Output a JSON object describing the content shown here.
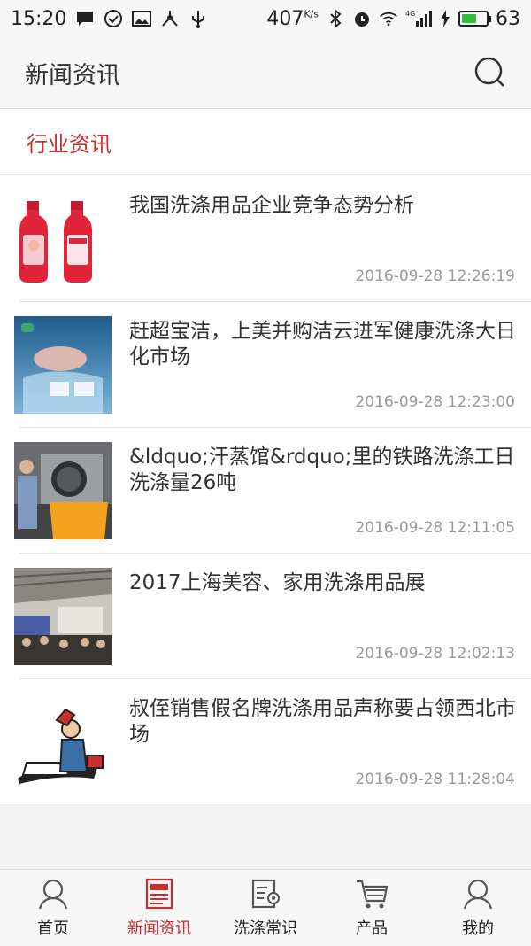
{
  "status_bar": {
    "time": "15:20",
    "net_speed": "407",
    "net_speed_unit": "K/s",
    "signal_type": "4G",
    "battery_level": "63"
  },
  "header": {
    "title": "新闻资讯",
    "search_icon": "search-icon"
  },
  "section": {
    "title": "行业资讯"
  },
  "news": [
    {
      "title": "我国洗涤用品企业竞争态势分析",
      "date": "2016-09-28 12:26:19",
      "thumb": "detergent-bottles"
    },
    {
      "title": "赶超宝洁，上美并购洁云进军健康洗涤大日化市场",
      "date": "2016-09-28 12:23:00",
      "thumb": "product-ad"
    },
    {
      "title": "&ldquo;汗蒸馆&rdquo;里的铁路洗涤工日洗涤量26吨",
      "date": "2016-09-28 12:11:05",
      "thumb": "laundry-worker"
    },
    {
      "title": "2017上海美容、家用洗涤用品展",
      "date": "2016-09-28 12:02:13",
      "thumb": "expo-hall"
    },
    {
      "title": "叔侄销售假名牌洗涤用品声称要占领西北市场",
      "date": "2016-09-28 11:28:04",
      "thumb": "cartoon"
    }
  ],
  "tabs": [
    {
      "label": "首页",
      "icon": "home-icon",
      "active": false
    },
    {
      "label": "新闻资讯",
      "icon": "news-icon",
      "active": true
    },
    {
      "label": "洗涤常识",
      "icon": "knowledge-icon",
      "active": false
    },
    {
      "label": "产品",
      "icon": "cart-icon",
      "active": false
    },
    {
      "label": "我的",
      "icon": "user-icon",
      "active": false
    }
  ],
  "colors": {
    "accent": "#c8302e",
    "date_text": "#999999",
    "battery": "#2fbf3a"
  }
}
